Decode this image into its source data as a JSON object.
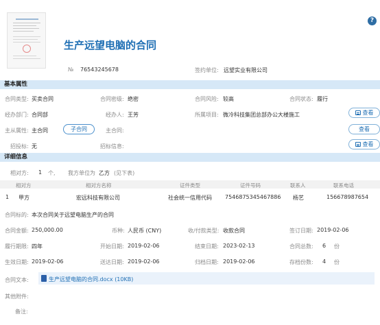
{
  "header": {
    "title": "生产远望电脑的合同",
    "help_label": "?",
    "no_label": "№",
    "no_value": "76543245678",
    "sign_unit_label": "签约单位:",
    "sign_unit_value": "远望实业有限公司"
  },
  "basic": {
    "section_title": "基本属性",
    "type_label": "合同类型:",
    "type_value": "买卖合同",
    "secret_label": "合同密级:",
    "secret_value": "绝密",
    "risk_label": "合同风险:",
    "risk_value": "较高",
    "status_label": "合同状态:",
    "status_value": "履行",
    "dept_label": "经办部门:",
    "dept_value": "合同部",
    "handler_label": "经办人:",
    "handler_value": "王芳",
    "project_label": "所属项目:",
    "project_value": "微冷科技集团总部办公大楼施工",
    "main_attr_label": "主从属性:",
    "main_attr_value": "主合同",
    "sub_contract_button": "子合同",
    "main_contract_label": "主合同:",
    "main_contract_value": "",
    "bid_label": "招投标:",
    "bid_value": "无",
    "bid_info_label": "招标信息:",
    "bid_info_value": "",
    "view_label": "查看"
  },
  "detail": {
    "section_title": "详细信息",
    "counterpart_label": "相对方:",
    "counterpart_count": "1",
    "counterpart_unit": "个,",
    "our_role_label": "我方单位为",
    "our_role_value": "乙方",
    "see_below": "(见下表)",
    "table_headers": [
      "相对方",
      "相对方名称",
      "证件类型",
      "证件号码",
      "联系人",
      "联系电话"
    ],
    "table_rows": [
      {
        "index": "1",
        "party": "甲方",
        "name": "宏远科技有限公司",
        "id_type": "社会统一信用代码",
        "id_no": "7546875345467886",
        "contact": "杨艺",
        "phone": "156678987654"
      }
    ],
    "target_label": "合同标的:",
    "target_value": "本次合同关于远望电脑生产的合同",
    "amount_label": "合同金额:",
    "amount_value": "250,000.00",
    "currency_label": "币种:",
    "currency_value": "人民币 (CNY)",
    "pay_type_label": "收/付款类型:",
    "pay_type_value": "收款合同",
    "sign_date_label": "签订日期:",
    "sign_date_value": "2019-02-06",
    "period_label": "履行期限:",
    "period_value": "四年",
    "start_label": "开始日期:",
    "start_value": "2019-02-06",
    "end_label": "结束日期:",
    "end_value": "2023-02-13",
    "copies_label": "合同总数:",
    "copies_value": "6",
    "copies_unit": "份",
    "effective_label": "生效日期:",
    "effective_value": "2019-02-06",
    "delivery_label": "送达日期:",
    "delivery_value": "2019-02-06",
    "archive_label": "归档日期:",
    "archive_value": "2019-02-06",
    "stored_label": "存档份数:",
    "stored_value": "4",
    "stored_unit": "份",
    "text_label": "合同文本:",
    "file_name": "生产远望电脑的合同.docx (10KB)",
    "attachment_label": "其他附件:",
    "remark_label": "备注:"
  },
  "colors": {
    "accent": "#1f6fb4",
    "section_bg": "#d6e8f7",
    "help_icon": "#2e6da4"
  }
}
